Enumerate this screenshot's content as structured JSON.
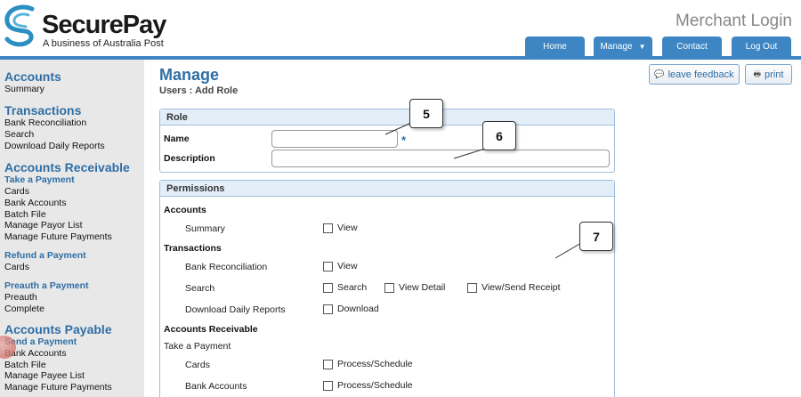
{
  "brand": {
    "name": "SecurePay",
    "tagline": "A business of Australia Post"
  },
  "header": {
    "title": "Merchant Login"
  },
  "nav": {
    "home": "Home",
    "manage": "Manage",
    "contact": "Contact",
    "logout": "Log Out"
  },
  "sidebar": {
    "accounts": {
      "heading": "Accounts",
      "summary": "Summary"
    },
    "transactions": {
      "heading": "Transactions",
      "bank_reconciliation": "Bank Reconciliation",
      "search": "Search",
      "download_daily_reports": "Download Daily Reports"
    },
    "accounts_receivable": {
      "heading": "Accounts Receivable",
      "take_a_payment": "Take a Payment",
      "cards": "Cards",
      "bank_accounts": "Bank Accounts",
      "batch_file": "Batch File",
      "manage_payor_list": "Manage Payor List",
      "manage_future_payments": "Manage Future Payments",
      "refund_a_payment": "Refund a Payment",
      "refund_cards": "Cards",
      "preauth_a_payment": "Preauth a Payment",
      "preauth": "Preauth",
      "complete": "Complete"
    },
    "accounts_payable": {
      "heading": "Accounts Payable",
      "send_a_payment": "Send a Payment",
      "bank_accounts": "Bank Accounts",
      "batch_file": "Batch File",
      "manage_payee_list": "Manage Payee List",
      "manage_future_payments": "Manage Future Payments"
    }
  },
  "page": {
    "title": "Manage",
    "subtitle": "Users : Add Role"
  },
  "toolbar": {
    "feedback": "leave feedback",
    "print": "print"
  },
  "role": {
    "heading": "Role",
    "name_label": "Name",
    "name_value": "",
    "required_mark": "*",
    "description_label": "Description",
    "description_value": ""
  },
  "permissions": {
    "heading": "Permissions",
    "accounts": "Accounts",
    "summary": "Summary",
    "view": "View",
    "transactions": "Transactions",
    "bank_reconciliation": "Bank Reconciliation",
    "search": "Search",
    "search_opt": "Search",
    "view_detail": "View Detail",
    "view_send_receipt": "View/Send Receipt",
    "download_daily_reports": "Download Daily Reports",
    "download": "Download",
    "accounts_receivable": "Accounts Receivable",
    "take_a_payment": "Take a Payment",
    "cards": "Cards",
    "bank_accounts": "Bank Accounts",
    "process_schedule": "Process/Schedule"
  },
  "callouts": {
    "c5": "5",
    "c6": "6",
    "c7": "7"
  }
}
